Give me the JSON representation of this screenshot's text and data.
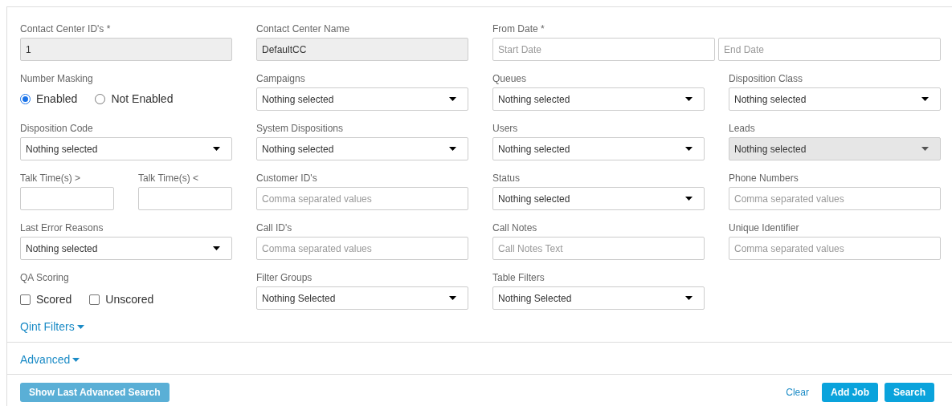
{
  "fields": [
    {
      "kind": "text",
      "label": "Contact Center ID's *",
      "value": "1",
      "disabled": true
    },
    {
      "kind": "text",
      "label": "Contact Center Name",
      "value": "DefaultCC",
      "disabled": true
    },
    {
      "kind": "date_range",
      "label": "From Date *",
      "start_placeholder": "Start Date",
      "end_placeholder": "End Date"
    },
    {
      "kind": "radio",
      "label": "Number Masking",
      "options": [
        {
          "label": "Enabled",
          "selected": true
        },
        {
          "label": "Not Enabled",
          "selected": false
        }
      ]
    },
    {
      "kind": "select",
      "label": "Campaigns",
      "value": "Nothing selected",
      "disabled": false
    },
    {
      "kind": "select",
      "label": "Queues",
      "value": "Nothing selected",
      "disabled": false
    },
    {
      "kind": "select",
      "label": "Disposition Class",
      "value": "Nothing selected",
      "disabled": false
    },
    {
      "kind": "select",
      "label": "Disposition Code",
      "value": "Nothing selected",
      "disabled": false
    },
    {
      "kind": "select",
      "label": "System Dispositions",
      "value": "Nothing selected",
      "disabled": false
    },
    {
      "kind": "select",
      "label": "Users",
      "value": "Nothing selected",
      "disabled": false
    },
    {
      "kind": "select",
      "label": "Leads",
      "value": "Nothing selected",
      "disabled": true
    },
    {
      "kind": "pair",
      "items": [
        {
          "label": "Talk Time(s) >"
        },
        {
          "label": "Talk Time(s) <"
        }
      ]
    },
    {
      "kind": "input",
      "label": "Customer ID's",
      "placeholder": "Comma separated values"
    },
    {
      "kind": "select",
      "label": "Status",
      "value": "Nothing selected",
      "disabled": false
    },
    {
      "kind": "input",
      "label": "Phone Numbers",
      "placeholder": "Comma separated values"
    },
    {
      "kind": "select",
      "label": "Last Error Reasons",
      "value": "Nothing selected",
      "disabled": false
    },
    {
      "kind": "input",
      "label": "Call ID's",
      "placeholder": "Comma separated values"
    },
    {
      "kind": "input",
      "label": "Call Notes",
      "placeholder": "Call Notes Text"
    },
    {
      "kind": "input",
      "label": "Unique Identifier",
      "placeholder": "Comma separated values"
    },
    {
      "kind": "checkboxes",
      "label": "QA Scoring",
      "options": [
        {
          "label": "Scored",
          "checked": false
        },
        {
          "label": "Unscored",
          "checked": false
        }
      ]
    },
    {
      "kind": "select",
      "label": "Filter Groups",
      "value": "Nothing Selected",
      "disabled": false
    },
    {
      "kind": "select",
      "label": "Table Filters",
      "value": "Nothing Selected",
      "disabled": false
    }
  ],
  "sections": [
    {
      "label": "Qint Filters"
    },
    {
      "label": "Advanced"
    }
  ],
  "buttons": [
    {
      "label": "Show Last Advanced Search",
      "kind": "primary",
      "disabled": true
    },
    {
      "label": "Clear",
      "kind": "link"
    },
    {
      "label": "Add Job",
      "kind": "primary",
      "disabled": false
    },
    {
      "label": "Search",
      "kind": "primary",
      "disabled": false
    }
  ]
}
